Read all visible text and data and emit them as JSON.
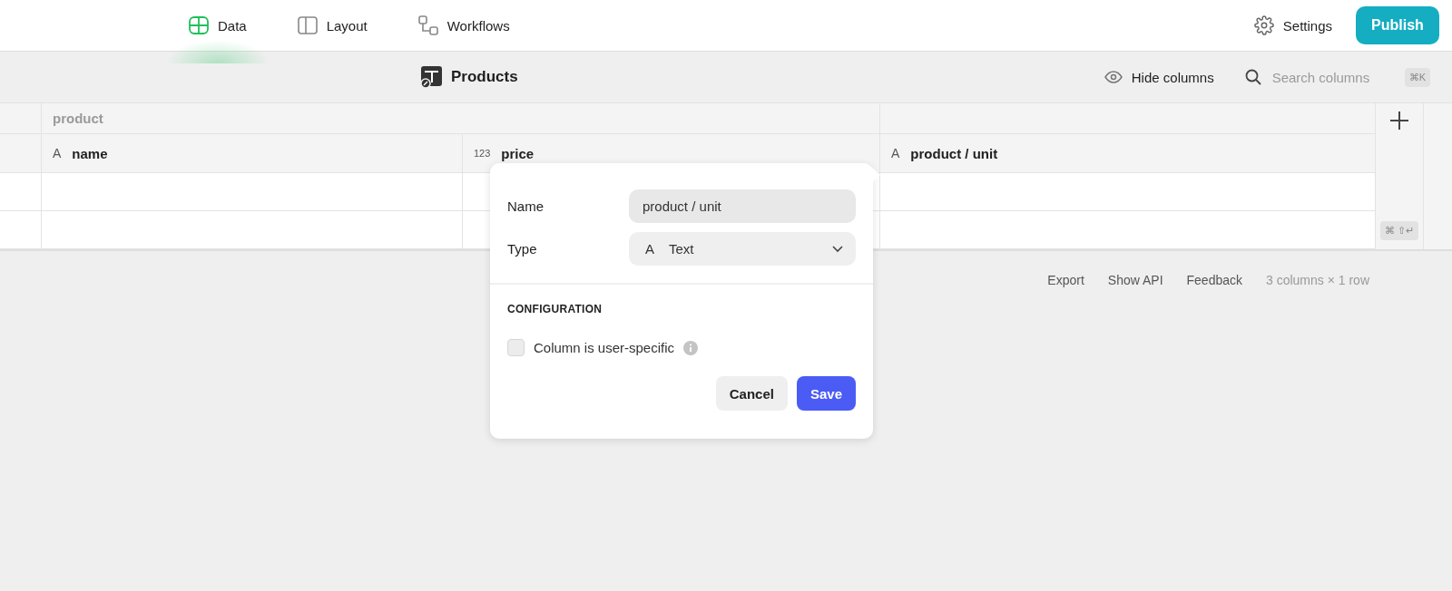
{
  "nav": {
    "tabs": [
      {
        "label": "Data",
        "selected": true
      },
      {
        "label": "Layout",
        "selected": false
      },
      {
        "label": "Workflows",
        "selected": false
      }
    ],
    "settings": "Settings",
    "publish": "Publish"
  },
  "toolbar": {
    "title": "Products",
    "hide_columns": "Hide columns",
    "search": {
      "placeholder": "Search columns"
    },
    "shortcut": "⌘K"
  },
  "table": {
    "group_header": "product",
    "columns": [
      {
        "type_label": "A",
        "name": "name"
      },
      {
        "type_label": "123",
        "name": "price"
      },
      {
        "type_label": "A",
        "name": "product / unit"
      }
    ],
    "add_shortcut": "⌘ ⇧↵"
  },
  "footer": {
    "links": [
      "Export",
      "Show API",
      "Feedback"
    ],
    "summary": "3 columns × 1 row"
  },
  "popover": {
    "name_label": "Name",
    "name_value": "product / unit",
    "type_label": "Type",
    "type_icon": "A",
    "type_value": "Text",
    "section": "CONFIGURATION",
    "checkbox": {
      "label": "Column is user-specific",
      "checked": false
    },
    "cancel": "Cancel",
    "save": "Save"
  }
}
